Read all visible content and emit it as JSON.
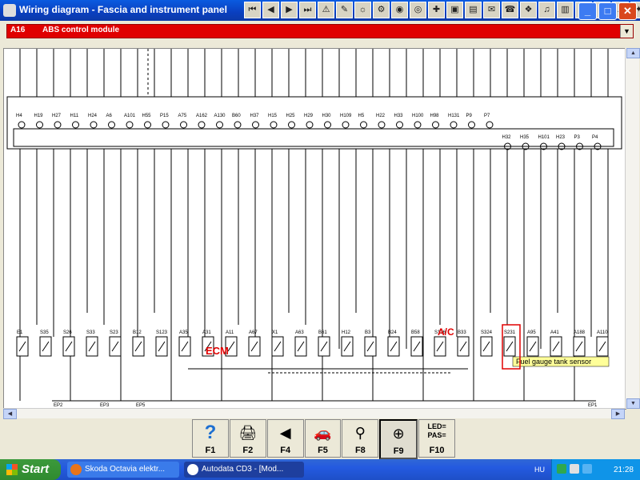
{
  "window": {
    "title": "Wiring diagram - Fascia and instrument panel",
    "toolbar_icons": [
      "first-icon",
      "prev-icon",
      "next-icon",
      "last-icon",
      "warning-icon",
      "tool-icon",
      "tool-icon",
      "tool-icon",
      "tool-icon",
      "tool-icon",
      "tool-icon",
      "tool-icon",
      "tool-icon",
      "tool-icon",
      "tool-icon",
      "tool-icon",
      "tool-icon",
      "tool-icon",
      "tool-icon",
      "tool-icon",
      "tool-icon",
      "tool-icon"
    ],
    "toolbar_glyphs": [
      "⏮",
      "◀",
      "▶",
      "⏭",
      "⚠",
      "✎",
      "☼",
      "⚙",
      "◉",
      "◎",
      "✚",
      "▣",
      "▤",
      "✉",
      "☎",
      "❖",
      "♫",
      "▥",
      "♣",
      "♦",
      "▲",
      "✦"
    ]
  },
  "component_select": {
    "code": "A16",
    "name": "ABS control module"
  },
  "diagram": {
    "title": "Fascia and instrument panel wiring",
    "instrument_labels": [
      "H4",
      "H19",
      "H27",
      "H11",
      "H24",
      "A6",
      "A101",
      "H55",
      "P15",
      "A75",
      "A162",
      "A130",
      "B60",
      "H37",
      "H15",
      "H25",
      "H29",
      "H30",
      "H109",
      "H5",
      "H22",
      "H33",
      "H100",
      "H98",
      "H131",
      "P9",
      "P7",
      "H32",
      "H35",
      "H101",
      "H23",
      "P3",
      "P4"
    ],
    "bottom_labels": [
      "E1",
      "S35",
      "S26",
      "S33",
      "S23",
      "B12",
      "S123",
      "A35",
      "A31",
      "A11",
      "A67",
      "X1",
      "A63",
      "B61",
      "H12",
      "B3",
      "B24",
      "B58",
      "S136",
      "B33",
      "S324",
      "S231",
      "A95",
      "A41",
      "A188",
      "A110"
    ],
    "ecm_label": "ECM",
    "ac_label": "A/C",
    "tooltip": "Fuel gauge tank sensor",
    "splice_labels": [
      "EP2",
      "EP3",
      "EP5",
      "EP1"
    ]
  },
  "function_keys": [
    {
      "key": "F1",
      "icon": "help-icon",
      "glyph": "?"
    },
    {
      "key": "F2",
      "icon": "print-icon",
      "glyph": "🖨"
    },
    {
      "key": "F4",
      "icon": "back-icon",
      "glyph": "◀"
    },
    {
      "key": "F5",
      "icon": "car-icon",
      "glyph": "🚗"
    },
    {
      "key": "F8",
      "icon": "component-locator-icon",
      "glyph": "⚲"
    },
    {
      "key": "F9",
      "icon": "zoom-icon",
      "glyph": "⊕",
      "pressed": true
    },
    {
      "key": "F10",
      "icon": "led-pas-icon",
      "glyph": "LED= PAS="
    }
  ],
  "taskbar": {
    "start": "Start",
    "tasks": [
      {
        "label": "Skoda Octavia elektr...",
        "icon": "firefox-icon",
        "color": "#e8741a",
        "active": false
      },
      {
        "label": "Autodata CD3 - [Mod...",
        "icon": "autodata-icon",
        "color": "#ffffff",
        "active": true
      }
    ],
    "lang": "HU",
    "clock": "21:28"
  }
}
